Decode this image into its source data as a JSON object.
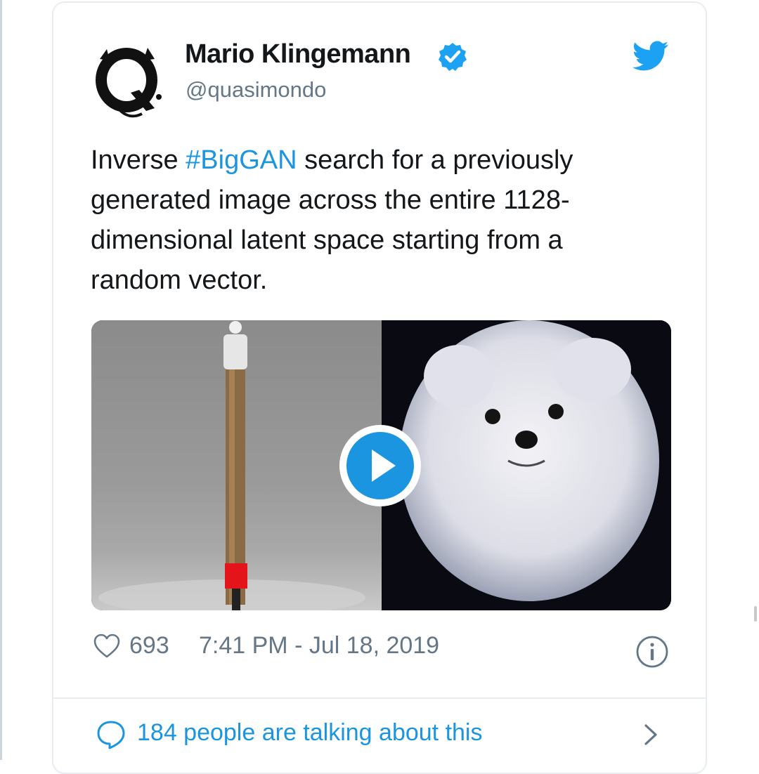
{
  "tweet": {
    "author": {
      "name": "Mario Klingemann",
      "handle": "@quasimondo",
      "verified": true,
      "avatar_icon": "q-monogram-avatar"
    },
    "text_before": "Inverse ",
    "hashtag": "#BigGAN",
    "text_after": " search for a previously generated image across the entire 1128-dimensional latent space starting from a random vector.",
    "media": {
      "type": "video",
      "left_panel": "generated-pole-image",
      "right_panel": "white-pomeranian-dog-image",
      "play_icon": "play-icon"
    },
    "likes": "693",
    "timestamp": "7:41 PM - Jul 18, 2019",
    "talking": "184 people are talking about this"
  },
  "colors": {
    "accent": "#1b95e0",
    "muted": "#657786",
    "text": "#14171a",
    "border": "#e6ecf0"
  },
  "icons": [
    "twitter-bird-icon",
    "verified-badge-icon",
    "heart-icon",
    "info-icon",
    "comment-bubble-icon",
    "chevron-right-icon"
  ]
}
